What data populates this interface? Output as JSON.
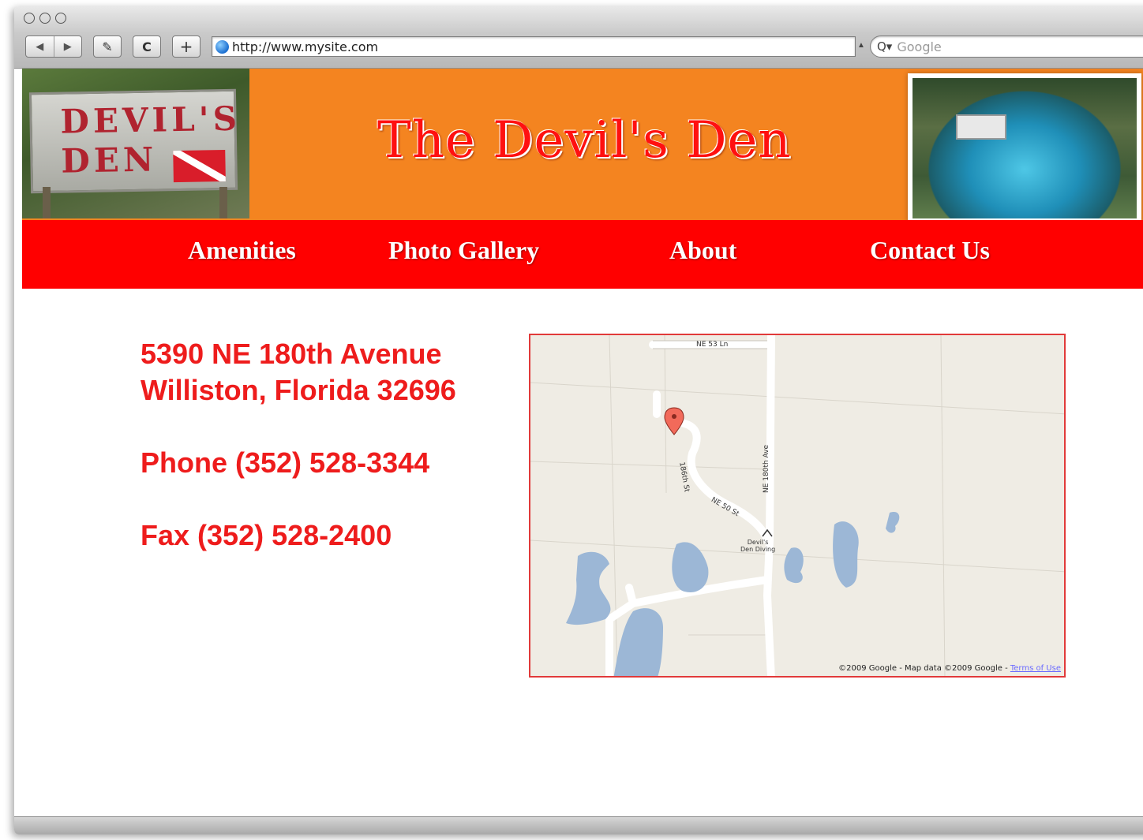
{
  "browser": {
    "url": "http://www.mysite.com",
    "search_placeholder": "Google",
    "back_glyph": "◀",
    "forward_glyph": "▶",
    "reload_glyph": "C",
    "add_glyph": "+"
  },
  "site": {
    "title": "The Devil's Den",
    "sign_line1": "DEVIL'S",
    "sign_line2": "DEN",
    "nav": [
      {
        "label": "Amenities"
      },
      {
        "label": "Photo Gallery"
      },
      {
        "label": "About"
      },
      {
        "label": "Contact Us"
      }
    ]
  },
  "contact": {
    "address_line1": "5390 NE 180th Avenue",
    "address_line2": "Williston, Florida 32696",
    "phone": "Phone (352) 528-3344",
    "fax": "Fax (352) 528-2400"
  },
  "map": {
    "road_ne53": "NE 53 Ln",
    "road_180th": "NE 180th Ave",
    "road_186th": "186th St",
    "road_ne50": "NE 50 St",
    "poi_line1": "Devil's",
    "poi_line2": "Den Diving",
    "copyright": "©2009 Google - Map data ©2009 Google - ",
    "terms": "Terms of Use"
  },
  "colors": {
    "header_orange": "#f48420",
    "nav_red": "#ff0000",
    "text_red": "#ee1c1c"
  }
}
